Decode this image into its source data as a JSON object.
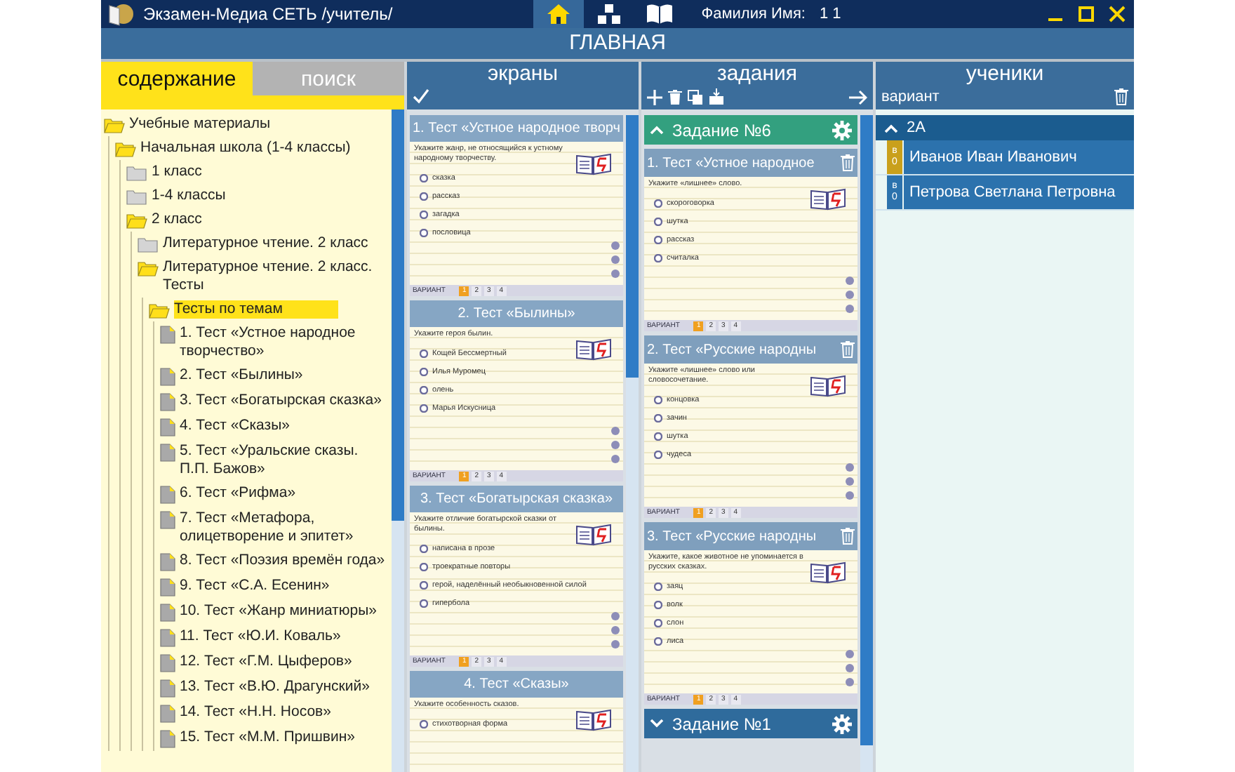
{
  "app_bar": {
    "title": "Экзамен-Медиа СЕТЬ /учитель/",
    "nav": [
      {
        "kind": "home",
        "selected": true
      },
      {
        "kind": "hierarchy",
        "selected": false
      },
      {
        "kind": "book",
        "selected": false
      }
    ],
    "user_label": "Фамилия Имя:",
    "user_value": "1 1"
  },
  "page_title": "ГЛАВНАЯ",
  "left_panel": {
    "tabs": [
      {
        "label": "содержание",
        "selected": true
      },
      {
        "label": "поиск",
        "selected": false
      }
    ],
    "tree": [
      {
        "label": "Учебные материалы",
        "kind": "folder",
        "expanded": true,
        "selected": false,
        "children": [
          {
            "label": "Начальная школа (1-4 классы)",
            "kind": "folder",
            "expanded": true,
            "selected": false,
            "children": [
              {
                "label": "1 класс",
                "kind": "folder",
                "expanded": false,
                "selected": false
              },
              {
                "label": "1-4 классы",
                "kind": "folder",
                "expanded": false,
                "selected": false
              },
              {
                "label": "2 класс",
                "kind": "folder",
                "expanded": true,
                "selected": false,
                "children": [
                  {
                    "label": "Литературное чтение. 2 класс",
                    "kind": "folder",
                    "expanded": false,
                    "selected": false
                  },
                  {
                    "label": "Литературное чтение. 2 класс. Тесты",
                    "kind": "folder",
                    "expanded": true,
                    "selected": false,
                    "children": [
                      {
                        "label": "Тесты по темам",
                        "kind": "folder",
                        "expanded": true,
                        "selected": true,
                        "children": [
                          {
                            "label": "1. Тест «Устное народное творчество»",
                            "kind": "test",
                            "selected": false
                          },
                          {
                            "label": "2. Тест «Былины»",
                            "kind": "test",
                            "selected": false
                          },
                          {
                            "label": "3. Тест «Богатырская сказка»",
                            "kind": "test",
                            "selected": false
                          },
                          {
                            "label": "4. Тест «Сказы»",
                            "kind": "test",
                            "selected": false
                          },
                          {
                            "label": "5. Тест «Уральские сказы. П.П. Бажов»",
                            "kind": "test",
                            "selected": false
                          },
                          {
                            "label": "6. Тест «Рифма»",
                            "kind": "test",
                            "selected": false
                          },
                          {
                            "label": "7. Тест «Метафора, олицетворение и эпитет»",
                            "kind": "test",
                            "selected": false
                          },
                          {
                            "label": "8. Тест «Поэзия времён года»",
                            "kind": "test",
                            "selected": false
                          },
                          {
                            "label": "9. Тест «С.А. Есенин»",
                            "kind": "test",
                            "selected": false
                          },
                          {
                            "label": "10. Тест «Жанр миниатюры»",
                            "kind": "test",
                            "selected": false
                          },
                          {
                            "label": "11. Тест «Ю.И. Коваль»",
                            "kind": "test",
                            "selected": false
                          },
                          {
                            "label": "12. Тест «Г.М. Цыферов»",
                            "kind": "test",
                            "selected": false
                          },
                          {
                            "label": "13. Тест «В.Ю. Драгунский»",
                            "kind": "test",
                            "selected": false
                          },
                          {
                            "label": "14. Тест «Н.Н. Носов»",
                            "kind": "test",
                            "selected": false
                          },
                          {
                            "label": "15. Тест «М.М. Пришвин»",
                            "kind": "test",
                            "selected": false
                          }
                        ]
                      }
                    ]
                  }
                ]
              }
            ]
          }
        ]
      }
    ]
  },
  "screens": {
    "title": "экраны",
    "items": [
      {
        "title": "1. Тест «Устное народное творч",
        "question": "Укажите жанр, не относящийся к устному народному творчеству.",
        "options": [
          "сказка",
          "рассказ",
          "загадка",
          "пословица"
        ],
        "variant_label": "ВАРИАНТ",
        "variants": [
          {
            "label": "1",
            "selected": true
          },
          {
            "label": "2",
            "selected": false
          },
          {
            "label": "3",
            "selected": false
          },
          {
            "label": "4",
            "selected": false
          }
        ]
      },
      {
        "title": "2. Тест «Былины»",
        "question": "Укажите героя былин.",
        "options": [
          "Кощей Бессмертный",
          "Илья Муромец",
          "олень",
          "Марья Искусница"
        ],
        "variant_label": "ВАРИАНТ",
        "variants": [
          {
            "label": "1",
            "selected": true
          },
          {
            "label": "2",
            "selected": false
          },
          {
            "label": "3",
            "selected": false
          },
          {
            "label": "4",
            "selected": false
          }
        ]
      },
      {
        "title": "3. Тест «Богатырская сказка»",
        "question": "Укажите отличие богатырской сказки от былины.",
        "options": [
          "написана в прозе",
          "троекратные повторы",
          "герой, наделённый необыкновенной силой",
          "гипербола"
        ],
        "variant_label": "ВАРИАНТ",
        "variants": [
          {
            "label": "1",
            "selected": true
          },
          {
            "label": "2",
            "selected": false
          },
          {
            "label": "3",
            "selected": false
          },
          {
            "label": "4",
            "selected": false
          }
        ]
      },
      {
        "title": "4. Тест «Сказы»",
        "question": "Укажите особенность сказов.",
        "options": [
          "стихотворная форма"
        ]
      }
    ]
  },
  "tasks": {
    "title": "задания",
    "groups": [
      {
        "title": "Задание №6",
        "expanded": true,
        "items": [
          {
            "title": "1. Тест «Устное народное",
            "question": "Укажите «лишнее» слово.",
            "options": [
              "скороговорка",
              "шутка",
              "рассказ",
              "считалка"
            ],
            "variant_label": "ВАРИАНТ",
            "variants": [
              {
                "label": "1",
                "selected": true
              },
              {
                "label": "2",
                "selected": false
              },
              {
                "label": "3",
                "selected": false
              },
              {
                "label": "4",
                "selected": false
              }
            ]
          },
          {
            "title": "2. Тест «Русские народны",
            "question": "Укажите «лишнее» слово или словосочетание.",
            "options": [
              "концовка",
              "зачин",
              "шутка",
              "чудеса"
            ],
            "variant_label": "ВАРИАНТ",
            "variants": [
              {
                "label": "1",
                "selected": true
              },
              {
                "label": "2",
                "selected": false
              },
              {
                "label": "3",
                "selected": false
              },
              {
                "label": "4",
                "selected": false
              }
            ]
          },
          {
            "title": "3. Тест «Русские народны",
            "question": "Укажите, какое животное не упоминается в русских сказках.",
            "options": [
              "заяц",
              "волк",
              "слон",
              "лиса"
            ],
            "variant_label": "ВАРИАНТ",
            "variants": [
              {
                "label": "1",
                "selected": true
              },
              {
                "label": "2",
                "selected": false
              },
              {
                "label": "3",
                "selected": false
              },
              {
                "label": "4",
                "selected": false
              }
            ]
          }
        ]
      },
      {
        "title": "Задание №1",
        "expanded": false
      }
    ]
  },
  "students": {
    "title": "ученики",
    "column_label": "вариант",
    "groups": [
      {
        "name": "2А",
        "expanded": true,
        "students": [
          {
            "name": "Иванов Иван Иванович",
            "variant_letter": "в",
            "variant_number": "0",
            "selected": true
          },
          {
            "name": "Петрова Светлана Петровна",
            "variant_letter": "в",
            "variant_number": "0",
            "selected": false
          }
        ]
      }
    ]
  }
}
